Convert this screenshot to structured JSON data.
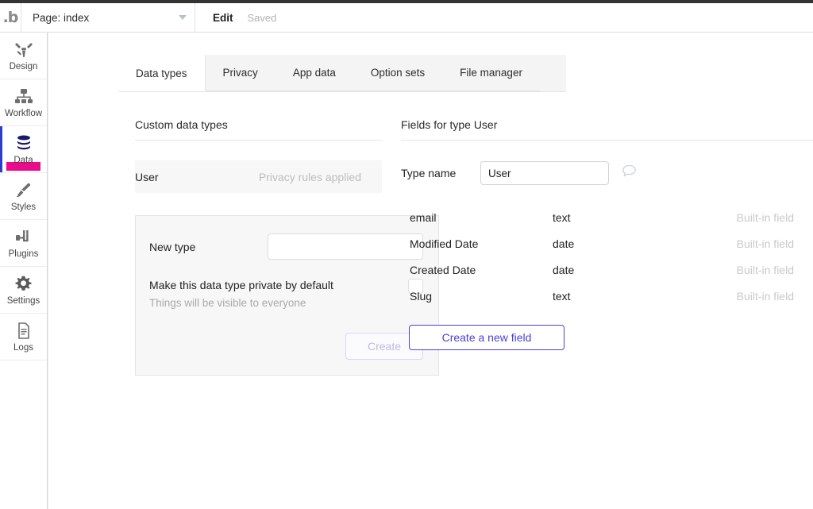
{
  "topbar": {
    "logo": "bubble-logo",
    "logo_text": ".b",
    "page_selector_label": "Page: index",
    "dropdown_icon": "chevron-down-icon",
    "edit_label": "Edit",
    "save_status": "Saved"
  },
  "sidebar": {
    "items": [
      {
        "label": "Design",
        "icon": "design-icon",
        "active": false
      },
      {
        "label": "Workflow",
        "icon": "workflow-icon",
        "active": false
      },
      {
        "label": "Data",
        "icon": "database-icon",
        "active": true
      },
      {
        "label": "Styles",
        "icon": "brush-icon",
        "active": false
      },
      {
        "label": "Plugins",
        "icon": "plug-icon",
        "active": false
      },
      {
        "label": "Settings",
        "icon": "gear-icon",
        "active": false
      },
      {
        "label": "Logs",
        "icon": "document-icon",
        "active": false
      }
    ],
    "active_indicator_color": "#2d3bd6",
    "highlight_color": "#eb0a8c"
  },
  "tabs": [
    {
      "label": "Data types",
      "active": true
    },
    {
      "label": "Privacy",
      "active": false
    },
    {
      "label": "App data",
      "active": false
    },
    {
      "label": "Option sets",
      "active": false
    },
    {
      "label": "File manager",
      "active": false
    }
  ],
  "left_panel": {
    "title": "Custom data types",
    "types": [
      {
        "name": "User",
        "status": "Privacy rules applied"
      }
    ],
    "new_type": {
      "label": "New type",
      "value": "",
      "placeholder": "",
      "private_label": "Make this data type private by default",
      "private_hint": "Things will be visible to everyone",
      "private_checked": false,
      "create_button": "Create",
      "create_button_enabled": false
    }
  },
  "right_panel": {
    "title": "Fields for type User",
    "type_name_label": "Type name",
    "type_name_value": "User",
    "comment_icon": "speech-bubble-icon",
    "fields": [
      {
        "name": "email",
        "type": "text",
        "note": "Built-in field"
      },
      {
        "name": "Modified Date",
        "type": "date",
        "note": "Built-in field"
      },
      {
        "name": "Created Date",
        "type": "date",
        "note": "Built-in field"
      },
      {
        "name": "Slug",
        "type": "text",
        "note": "Built-in field"
      }
    ],
    "create_field_button": "Create a new field",
    "accent_color": "#4a41d4"
  }
}
